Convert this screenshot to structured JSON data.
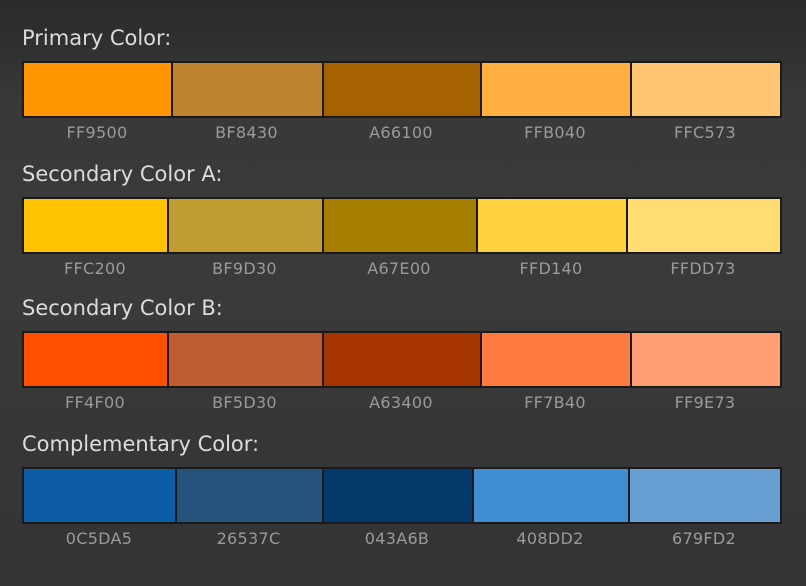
{
  "groups": [
    {
      "title": "Primary Color:",
      "swatches": [
        {
          "hex": "FF9500",
          "color": "#FF9500"
        },
        {
          "hex": "BF8430",
          "color": "#BF8430"
        },
        {
          "hex": "A66100",
          "color": "#A66100"
        },
        {
          "hex": "FFB040",
          "color": "#FFB040"
        },
        {
          "hex": "FFC573",
          "color": "#FFC573"
        }
      ]
    },
    {
      "title": "Secondary Color A:",
      "swatches": [
        {
          "hex": "FFC200",
          "color": "#FFC200"
        },
        {
          "hex": "BF9D30",
          "color": "#BF9D30"
        },
        {
          "hex": "A67E00",
          "color": "#A67E00"
        },
        {
          "hex": "FFD140",
          "color": "#FFD140"
        },
        {
          "hex": "FFDD73",
          "color": "#FFDD73"
        }
      ]
    },
    {
      "title": "Secondary Color B:",
      "swatches": [
        {
          "hex": "FF4F00",
          "color": "#FF4F00"
        },
        {
          "hex": "BF5D30",
          "color": "#BF5D30"
        },
        {
          "hex": "A63400",
          "color": "#A63400"
        },
        {
          "hex": "FF7B40",
          "color": "#FF7B40"
        },
        {
          "hex": "FF9E73",
          "color": "#FF9E73"
        }
      ]
    },
    {
      "title": "Complementary Color:",
      "swatches": [
        {
          "hex": "0C5DA5",
          "color": "#0C5DA5"
        },
        {
          "hex": "26537C",
          "color": "#26537C"
        },
        {
          "hex": "043A6B",
          "color": "#043A6B"
        },
        {
          "hex": "408DD2",
          "color": "#408DD2"
        },
        {
          "hex": "679FD2",
          "color": "#679FD2"
        }
      ]
    }
  ]
}
